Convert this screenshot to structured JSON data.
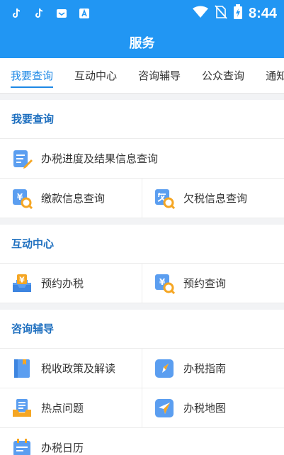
{
  "status": {
    "time": "8:44",
    "left_icons": [
      "tiktok-icon",
      "tiktok-icon",
      "mail-box-icon",
      "font-a-icon"
    ]
  },
  "header": {
    "title": "服务"
  },
  "tabs": [
    {
      "label": "我要查询",
      "active": true
    },
    {
      "label": "互动中心",
      "active": false
    },
    {
      "label": "咨询辅导",
      "active": false
    },
    {
      "label": "公众查询",
      "active": false
    },
    {
      "label": "通知",
      "active": false
    }
  ],
  "sections": [
    {
      "title": "我要查询",
      "items": [
        {
          "label": "办税进度及结果信息查询",
          "icon": "document-edit-icon"
        },
        {
          "label": "缴款信息查询",
          "icon": "yuan-search-icon"
        },
        {
          "label": "欠税信息查询",
          "icon": "owe-search-icon"
        }
      ]
    },
    {
      "title": "互动中心",
      "items": [
        {
          "label": "预约办税",
          "icon": "yuan-tray-icon"
        },
        {
          "label": "预约查询",
          "icon": "yuan-search-icon"
        }
      ]
    },
    {
      "title": "咨询辅导",
      "items": [
        {
          "label": "税收政策及解读",
          "icon": "book-icon"
        },
        {
          "label": "办税指南",
          "icon": "compass-icon"
        },
        {
          "label": "热点问题",
          "icon": "inbox-list-icon"
        },
        {
          "label": "办税地图",
          "icon": "navigation-arrow-icon"
        },
        {
          "label": "办税日历",
          "icon": "calendar-icon"
        }
      ]
    }
  ],
  "colors": {
    "primary": "#2196f3",
    "accent": "#1e88e5",
    "section_title": "#1e6fbf",
    "icon_orange": "#f5a623"
  }
}
